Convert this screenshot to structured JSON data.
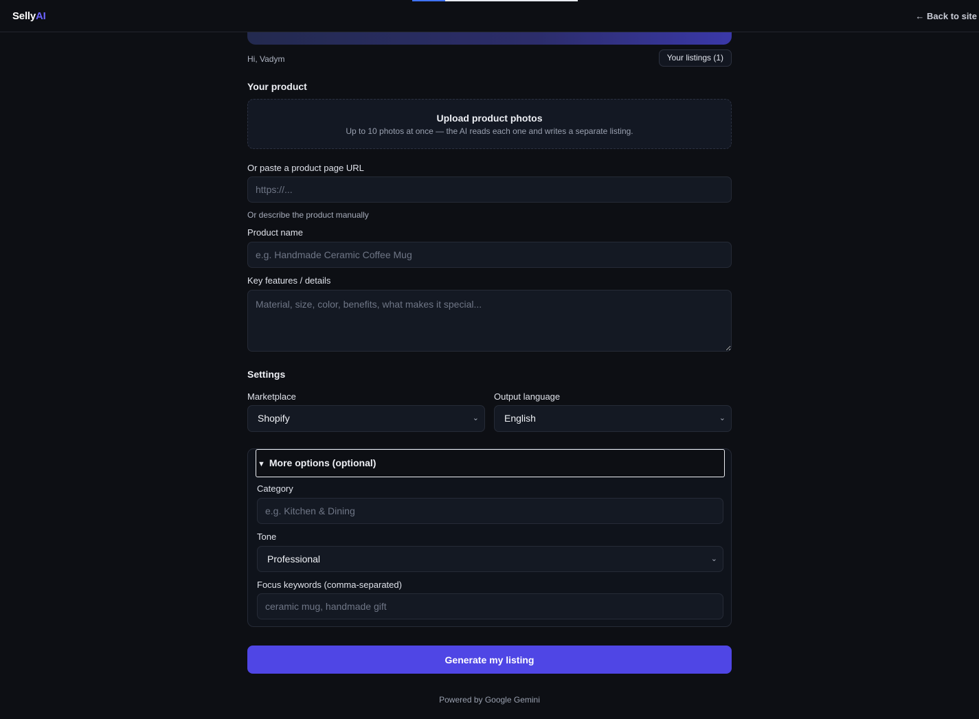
{
  "topbar": {
    "brand_part1": "Selly",
    "brand_part2": "AI",
    "back_link": "← Back to site",
    "progress_fraction": 0.2
  },
  "header": {
    "greeting": "Hi, Vadym",
    "listings_button": "Your listings (1)"
  },
  "product": {
    "section_title": "Your product",
    "upload_title": "Upload product photos",
    "upload_subtitle": "Up to 10 photos at once — the AI reads each one and writes a separate listing.",
    "url_label": "Or paste a product page URL",
    "url_placeholder": "https://...",
    "manual_label": "Or describe the product manually",
    "name_label": "Product name",
    "name_placeholder": "e.g. Handmade Ceramic Coffee Mug",
    "features_label": "Key features / details",
    "features_placeholder": "Material, size, color, benefits, what makes it special..."
  },
  "settings": {
    "section_title": "Settings",
    "marketplace_label": "Marketplace",
    "marketplace_value": "Shopify",
    "language_label": "Output language",
    "language_value": "English"
  },
  "more_options": {
    "summary": "More options (optional)",
    "category_label": "Category",
    "category_placeholder": "e.g. Kitchen & Dining",
    "tone_label": "Tone",
    "tone_value": "Professional",
    "keywords_label": "Focus keywords (comma-separated)",
    "keywords_placeholder": "ceramic mug, handmade gift"
  },
  "actions": {
    "generate_button": "Generate my listing"
  },
  "footer": {
    "text": "Powered by Google Gemini"
  },
  "colors": {
    "background": "#0d0f14",
    "accent": "#4f46e5",
    "brand_ai": "#6b63ff"
  }
}
